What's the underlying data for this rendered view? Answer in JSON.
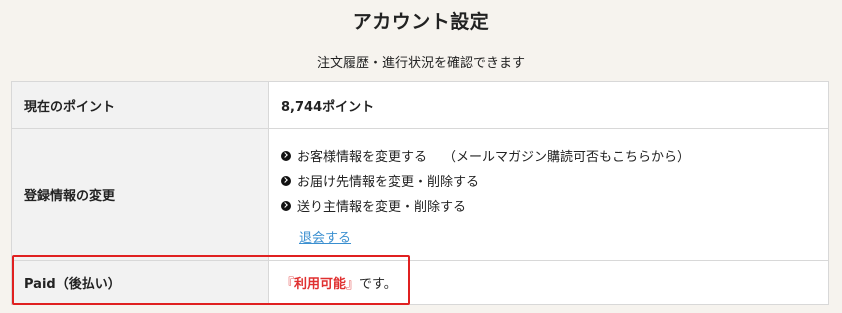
{
  "header": {
    "title": "アカウント設定",
    "subtitle": "注文履歴・進行状況を確認できます"
  },
  "table": {
    "points": {
      "label": "現在のポイント",
      "value": "8,744ポイント"
    },
    "registration": {
      "label": "登録情報の変更",
      "links": [
        {
          "text": "お客様情報を変更する",
          "note": "（メールマガジン購読可否もこちらから）"
        },
        {
          "text": "お届け先情報を変更・削除する",
          "note": ""
        },
        {
          "text": "送り主情報を変更・削除する",
          "note": ""
        }
      ],
      "withdraw": "退会する",
      "link_icon": "circle-arrow-right-icon"
    },
    "paid": {
      "label": "Paid（後払い）",
      "bracket_open": "『",
      "status": "利用可能",
      "bracket_close": "』",
      "suffix": "です。"
    }
  },
  "colors": {
    "page_bg": "#f6f3ee",
    "header_cell_bg": "#f2f2f2",
    "link": "#3a8fd0",
    "accent_red": "#e03030",
    "highlight_border": "#e02020"
  }
}
